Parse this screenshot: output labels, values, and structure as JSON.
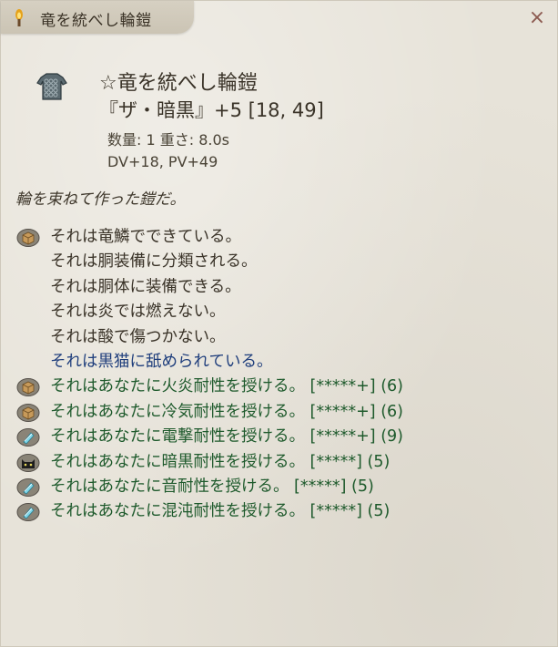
{
  "window": {
    "title": "竜を統べし輪鎧",
    "close_label": "×"
  },
  "item": {
    "name": "☆竜を統べし輪鎧",
    "subtitle": "『ザ・暗黒』+5 [18, 49]",
    "stats_line1": "数量: 1  重さ: 8.0s",
    "stats_line2": "DV+18, PV+49",
    "icon": "chainmail-icon"
  },
  "description": "輪を束ねて作った鎧だ。",
  "properties": [
    {
      "text": "それは竜鱗でできている。",
      "icon": "box-icon",
      "color": "#3a3328"
    },
    {
      "text": "それは胴装備に分類される。",
      "icon": "",
      "color": "#3a3328"
    },
    {
      "text": "それは胴体に装備できる。",
      "icon": "",
      "color": "#3a3328"
    },
    {
      "text": "それは炎では燃えない。",
      "icon": "",
      "color": "#3a3328"
    },
    {
      "text": "それは酸で傷つかない。",
      "icon": "",
      "color": "#3a3328"
    },
    {
      "text": "それは黒猫に舐められている。",
      "icon": "",
      "color": "#1f3e7c"
    },
    {
      "text": "それはあなたに火炎耐性を授ける。 [*****+] (6)",
      "icon": "box-icon",
      "color": "#1e5a2c"
    },
    {
      "text": "それはあなたに冷気耐性を授ける。 [*****+] (6)",
      "icon": "box-icon",
      "color": "#1e5a2c"
    },
    {
      "text": "それはあなたに電撃耐性を授ける。 [*****+] (9)",
      "icon": "crystal-icon",
      "color": "#1e5a2c"
    },
    {
      "text": "それはあなたに暗黒耐性を授ける。 [*****] (5)",
      "icon": "cat-icon",
      "color": "#1e5a2c"
    },
    {
      "text": "それはあなたに音耐性を授ける。 [*****] (5)",
      "icon": "crystal-icon",
      "color": "#1e5a2c"
    },
    {
      "text": "それはあなたに混沌耐性を授ける。 [*****] (5)",
      "icon": "crystal-icon",
      "color": "#1e5a2c"
    }
  ]
}
